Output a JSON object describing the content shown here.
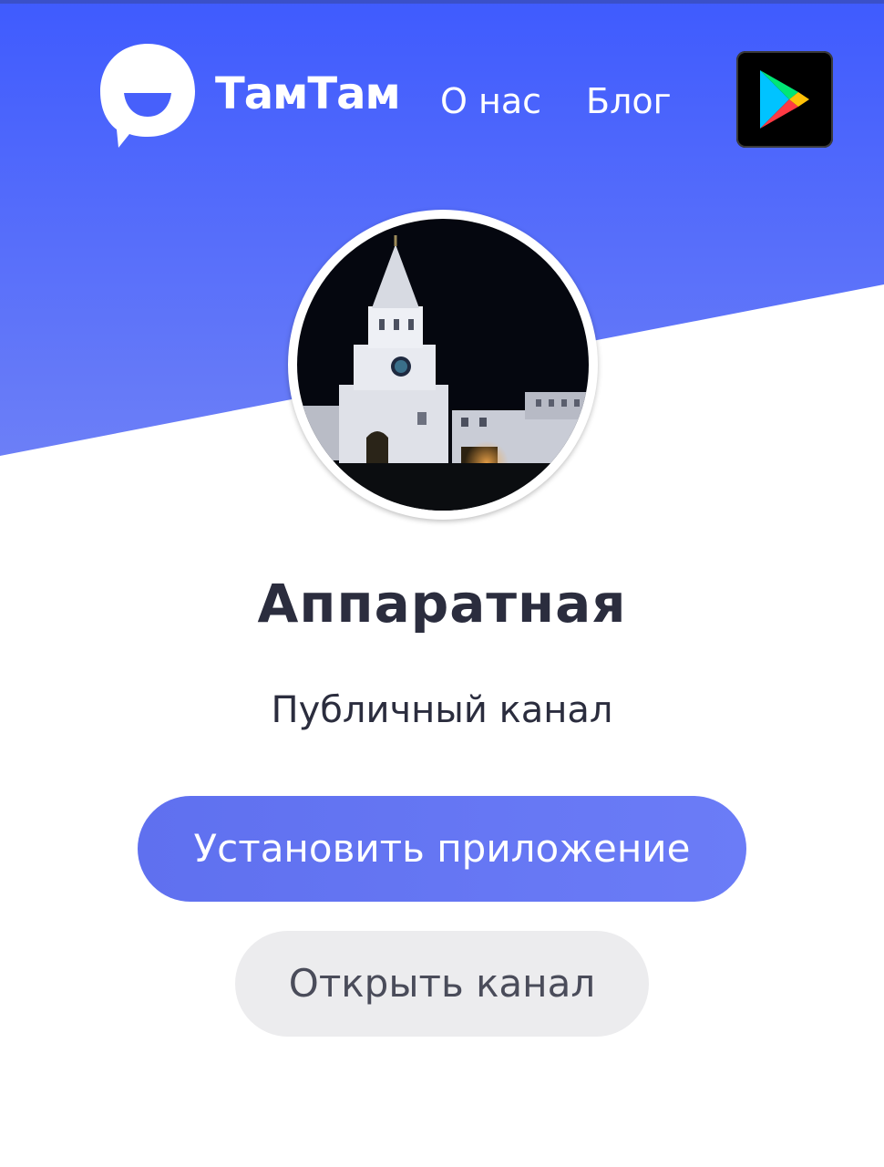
{
  "header": {
    "brand": "ТамТам",
    "nav": [
      {
        "label": "О нас"
      },
      {
        "label": "Блог"
      }
    ],
    "store_icon": "google-play-icon"
  },
  "channel": {
    "avatar_icon": "kremlin-tower-photo",
    "title": "Аппаратная",
    "subtitle": "Публичный канал"
  },
  "actions": {
    "install_label": "Установить приложение",
    "open_label": "Открыть канал"
  },
  "colors": {
    "hero_top": "#3d5afe",
    "hero_bottom": "#6a7cf6",
    "primary_button": "#6374f2",
    "secondary_button": "#ececee",
    "title_text": "#2b2d3e"
  }
}
